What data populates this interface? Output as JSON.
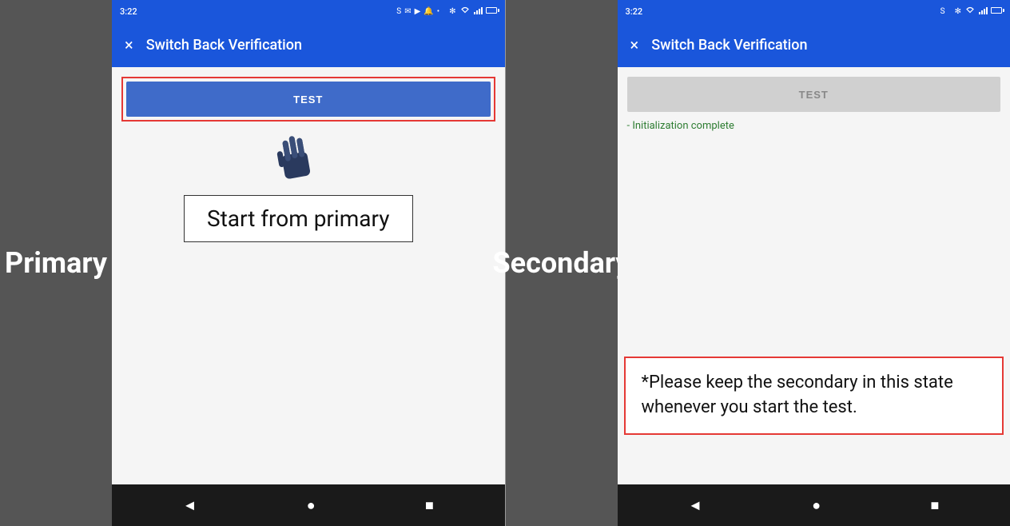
{
  "left": {
    "label": "Primary",
    "statusBar": {
      "time": "3:22",
      "icons": "🔵 ⬛ 📶 🔔"
    },
    "appBar": {
      "close": "×",
      "title": "Switch Back Verification"
    },
    "testButton": "TEST",
    "startFromPrimary": "Start from primary",
    "navButtons": [
      "◄",
      "●",
      "■"
    ]
  },
  "right": {
    "label": "Secondary",
    "statusBar": {
      "time": "3:22"
    },
    "appBar": {
      "close": "×",
      "title": "Switch Back Verification"
    },
    "testButton": "TEST",
    "initText": "- Initialization complete",
    "noteText": "*Please keep the secondary in this state whenever you start the test.",
    "navButtons": [
      "◄",
      "●",
      "■"
    ]
  }
}
